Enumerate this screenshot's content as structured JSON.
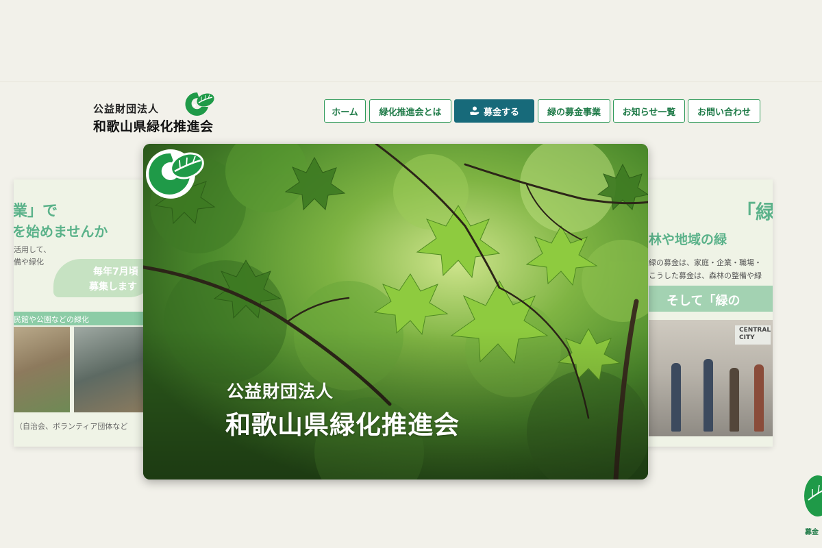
{
  "brand": {
    "org_type": "公益財団法人",
    "org_name": "和歌山県緑化推進会",
    "logo_icon": "green-g-leaf-logo"
  },
  "nav": {
    "items": [
      {
        "label": "ホーム"
      },
      {
        "label": "緑化推進会とは"
      },
      {
        "label": "募金する",
        "icon": "donate-hand-icon",
        "primary": true
      },
      {
        "label": "緑の募金事業"
      },
      {
        "label": "お知らせ一覧"
      },
      {
        "label": "お問い合わせ"
      }
    ]
  },
  "carousel": {
    "left_slide": {
      "heading_1": "業」で",
      "heading_2": "を始めませんか",
      "text_1": "活用して、",
      "text_2": "備や緑化",
      "bubble_1": "毎年7月頃",
      "bubble_2": "募集します",
      "band": "民館や公園などの緑化",
      "caption": "（自治会、ボランティア団体など"
    },
    "main_slide": {
      "org_type": "公益財団法人",
      "org_name": "和歌山県緑化推進会"
    },
    "right_slide": {
      "heading_1": "「緑",
      "heading_2": "林や地域の緑",
      "text_1": "緑の募金は、家庭・企業・職場・",
      "text_2": "こうした募金は、森林の整備や緑",
      "band": "そして「緑の",
      "sign": "CENTRAL CITY"
    }
  },
  "floating_badge": {
    "label": "募金",
    "icon": "green-leaf-badge-icon"
  },
  "colors": {
    "page_bg": "#f2f1ea",
    "brand_green": "#1e7a47",
    "nav_border": "#2f9a5a",
    "primary_button": "#176a7a",
    "slide_green": "#5bb28a"
  }
}
